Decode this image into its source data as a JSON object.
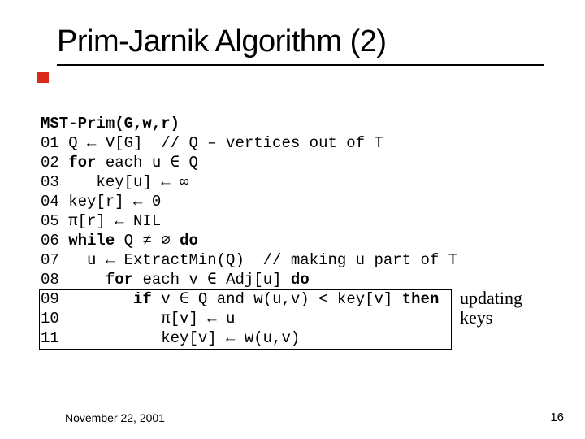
{
  "title": "Prim-Jarnik Algorithm (2)",
  "code": {
    "signature": "MST-Prim(G,w,r)",
    "lines": [
      {
        "num": "01",
        "pre": " Q ← V[G]  // Q – vertices out of T",
        "kw": "",
        "post": ""
      },
      {
        "num": "02",
        "pre": " ",
        "kw": "for",
        "post": " each u ∈ Q"
      },
      {
        "num": "03",
        "pre": "    key[u] ← ∞",
        "kw": "",
        "post": ""
      },
      {
        "num": "04",
        "pre": " key[r] ← 0",
        "kw": "",
        "post": ""
      },
      {
        "num": "05",
        "pre": " π[r] ← NIL",
        "kw": "",
        "post": ""
      },
      {
        "num": "06",
        "pre": " ",
        "kw": "while",
        "post": " Q ≠ ∅ ",
        "kw2": "do",
        "post2": ""
      },
      {
        "num": "07",
        "pre": "   u ← ExtractMin(Q)  // making u part of T",
        "kw": "",
        "post": ""
      },
      {
        "num": "08",
        "pre": "     ",
        "kw": "for",
        "post": " each v ∈ Adj[u] ",
        "kw2": "do",
        "post2": ""
      },
      {
        "num": "09",
        "pre": "        ",
        "kw": "if",
        "post": " v ∈ Q and w(u,v) < key[v] ",
        "kw2": "then",
        "post2": ""
      },
      {
        "num": "10",
        "pre": "           π[v] ← u",
        "kw": "",
        "post": ""
      },
      {
        "num": "11",
        "pre": "           key[v] ← w(u,v)",
        "kw": "",
        "post": ""
      }
    ]
  },
  "annotation": {
    "line1": "updating",
    "line2": "keys"
  },
  "footer": {
    "date": "November 22, 2001",
    "page": "16"
  }
}
